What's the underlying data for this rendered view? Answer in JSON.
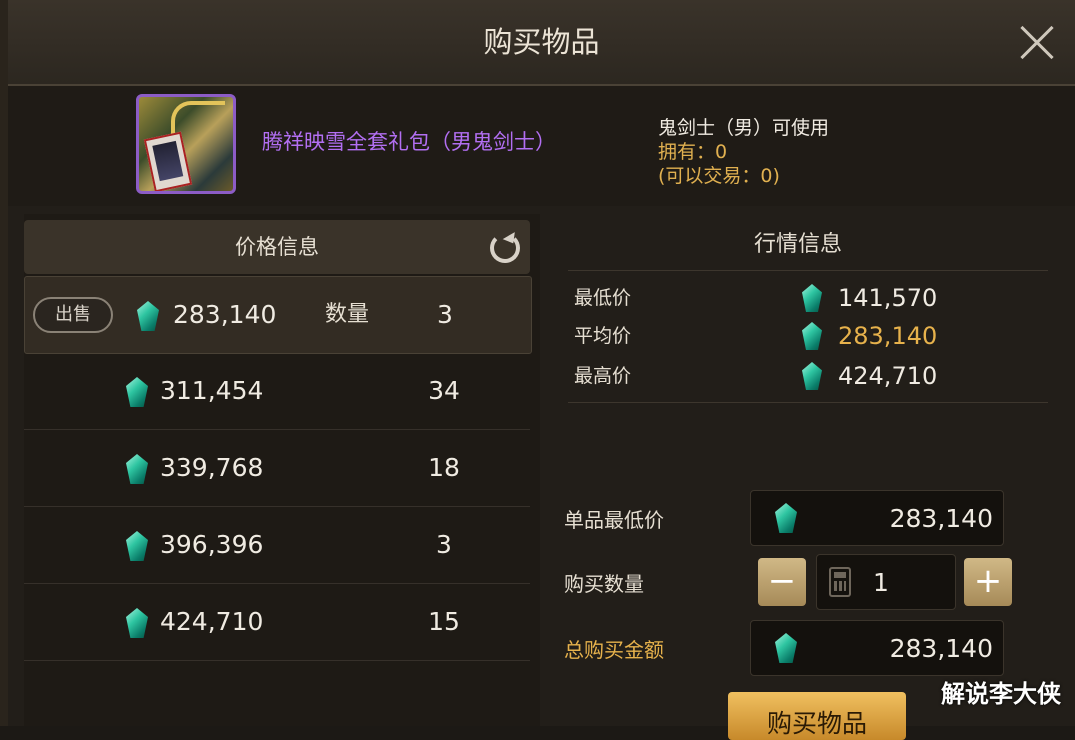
{
  "dialog": {
    "title": "购买物品"
  },
  "item": {
    "name": "腾祥映雪全套礼包（男鬼剑士）",
    "usable_by": "鬼剑士（男）可使用",
    "owned": "拥有：0",
    "tradable": "(可以交易：0)"
  },
  "price_info": {
    "header": "价格信息",
    "sell_label": "出售",
    "qty_label": "数量",
    "rows": [
      {
        "price": "283,140",
        "qty": "3"
      },
      {
        "price": "311,454",
        "qty": "34"
      },
      {
        "price": "339,768",
        "qty": "18"
      },
      {
        "price": "396,396",
        "qty": "3"
      },
      {
        "price": "424,710",
        "qty": "15"
      }
    ]
  },
  "market": {
    "title": "行情信息",
    "min_label": "最低价",
    "min_value": "141,570",
    "avg_label": "平均价",
    "avg_value": "283,140",
    "max_label": "最高价",
    "max_value": "424,710"
  },
  "purchase": {
    "unit_min_label": "单品最低价",
    "unit_min_value": "283,140",
    "quantity_label": "购买数量",
    "quantity_value": "1",
    "minus": "−",
    "plus": "+",
    "total_label": "总购买金额",
    "total_value": "283,140",
    "buy_button": "购买物品"
  },
  "watermark": "解说李大侠",
  "colors": {
    "accent_gold": "#e7b24c",
    "item_purple": "#b26ff2",
    "gem_teal": "#2fc6a2"
  }
}
